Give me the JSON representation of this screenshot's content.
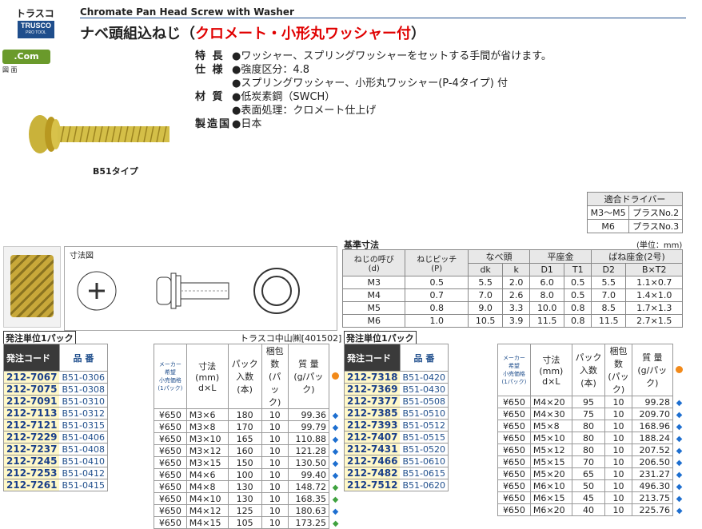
{
  "header": {
    "category": "トラスコ",
    "logo": "TRUSCO",
    "logo_sub": "PRO TOOL",
    "en_title": "Chromate Pan Head Screw with Washer",
    "jp_title_a": "ナベ頭組込ねじ（",
    "jp_title_b": "クロメート・小形丸ワッシャー付",
    "jp_title_c": "）"
  },
  "badges": {
    "com": ".Com",
    "fig": "図 面"
  },
  "spec": [
    {
      "k": "特 長",
      "v": "●ワッシャー、スプリングワッシャーをセットする手間が省けます。"
    },
    {
      "k": "仕 様",
      "v": "●強度区分：4.8"
    },
    {
      "k": "",
      "v": "●スプリングワッシャー、小形丸ワッシャー(P-4タイプ) 付"
    },
    {
      "k": "材 質",
      "v": "●低炭素鋼（SWCH）"
    },
    {
      "k": "",
      "v": "●表面処理：クロメート仕上げ"
    },
    {
      "k": "製造国",
      "v": "●日本"
    }
  ],
  "type_label": "B51タイプ",
  "driver": {
    "header": "適合ドライバー",
    "rows": [
      [
        "M3〜M5",
        "プラスNo.2"
      ],
      [
        "M6",
        "プラスNo.3"
      ]
    ]
  },
  "dimension_label": "寸法図",
  "std": {
    "title": "基準寸法",
    "unit": "(単位：mm)",
    "h1": [
      "ねじの呼び\n(d)",
      "ねじピッチ\n(P)",
      "なべ頭",
      "平座金",
      "ばね座金(2号)"
    ],
    "h2": [
      "dk",
      "k",
      "D1",
      "T1",
      "D2",
      "B×T2"
    ],
    "rows": [
      [
        "M3",
        "0.5",
        "5.5",
        "2.0",
        "6.0",
        "0.5",
        "5.5",
        "1.1×0.7"
      ],
      [
        "M4",
        "0.7",
        "7.0",
        "2.6",
        "8.0",
        "0.5",
        "7.0",
        "1.4×1.0"
      ],
      [
        "M5",
        "0.8",
        "9.0",
        "3.3",
        "10.0",
        "0.8",
        "8.5",
        "1.7×1.3"
      ],
      [
        "M6",
        "1.0",
        "10.5",
        "3.9",
        "11.5",
        "0.8",
        "11.5",
        "2.7×1.5"
      ]
    ]
  },
  "order": {
    "unit_label": "発注単位1パック",
    "maker": "トラスコ中山㈱[401502]",
    "h_code": "発注コード",
    "h_part": "品 番",
    "h_price": "メーカー希望\n小売価格\n(1パック)",
    "h_size": "寸法(mm)\nd×L",
    "h_pack": "パック入数\n(本)",
    "h_box": "梱包数\n(パック)",
    "h_weight": "質 量\n(g/パック)",
    "left": [
      [
        "212-7067",
        "B51-0306",
        "¥650",
        "M3×6",
        "180",
        "10",
        "99.36",
        "b"
      ],
      [
        "212-7075",
        "B51-0308",
        "¥650",
        "M3×8",
        "170",
        "10",
        "99.79",
        "b"
      ],
      [
        "212-7091",
        "B51-0310",
        "¥650",
        "M3×10",
        "165",
        "10",
        "110.88",
        "b"
      ],
      [
        "212-7113",
        "B51-0312",
        "¥650",
        "M3×12",
        "160",
        "10",
        "121.28",
        "b"
      ],
      [
        "212-7121",
        "B51-0315",
        "¥650",
        "M3×15",
        "150",
        "10",
        "130.50",
        "b"
      ],
      [
        "212-7229",
        "B51-0406",
        "¥650",
        "M4×6",
        "100",
        "10",
        "99.40",
        "b"
      ],
      [
        "212-7237",
        "B51-0408",
        "¥650",
        "M4×8",
        "130",
        "10",
        "148.72",
        "g"
      ],
      [
        "212-7245",
        "B51-0410",
        "¥650",
        "M4×10",
        "130",
        "10",
        "168.35",
        "g"
      ],
      [
        "212-7253",
        "B51-0412",
        "¥650",
        "M4×12",
        "125",
        "10",
        "180.63",
        "b"
      ],
      [
        "212-7261",
        "B51-0415",
        "¥650",
        "M4×15",
        "105",
        "10",
        "173.25",
        "g"
      ]
    ],
    "right": [
      [
        "212-7318",
        "B51-0420",
        "¥650",
        "M4×20",
        "95",
        "10",
        "99.28",
        "b"
      ],
      [
        "212-7369",
        "B51-0430",
        "¥650",
        "M4×30",
        "75",
        "10",
        "209.70",
        "b"
      ],
      [
        "212-7377",
        "B51-0508",
        "¥650",
        "M5×8",
        "80",
        "10",
        "168.96",
        "b"
      ],
      [
        "212-7385",
        "B51-0510",
        "¥650",
        "M5×10",
        "80",
        "10",
        "188.24",
        "b"
      ],
      [
        "212-7393",
        "B51-0512",
        "¥650",
        "M5×12",
        "80",
        "10",
        "207.52",
        "b"
      ],
      [
        "212-7407",
        "B51-0515",
        "¥650",
        "M5×15",
        "70",
        "10",
        "206.50",
        "b"
      ],
      [
        "212-7431",
        "B51-0520",
        "¥650",
        "M5×20",
        "65",
        "10",
        "231.27",
        "b"
      ],
      [
        "212-7466",
        "B51-0610",
        "¥650",
        "M6×10",
        "50",
        "10",
        "496.30",
        "b"
      ],
      [
        "212-7482",
        "B51-0615",
        "¥650",
        "M6×15",
        "45",
        "10",
        "213.75",
        "b"
      ],
      [
        "212-7512",
        "B51-0620",
        "¥650",
        "M6×20",
        "40",
        "10",
        "225.76",
        "b"
      ]
    ]
  }
}
